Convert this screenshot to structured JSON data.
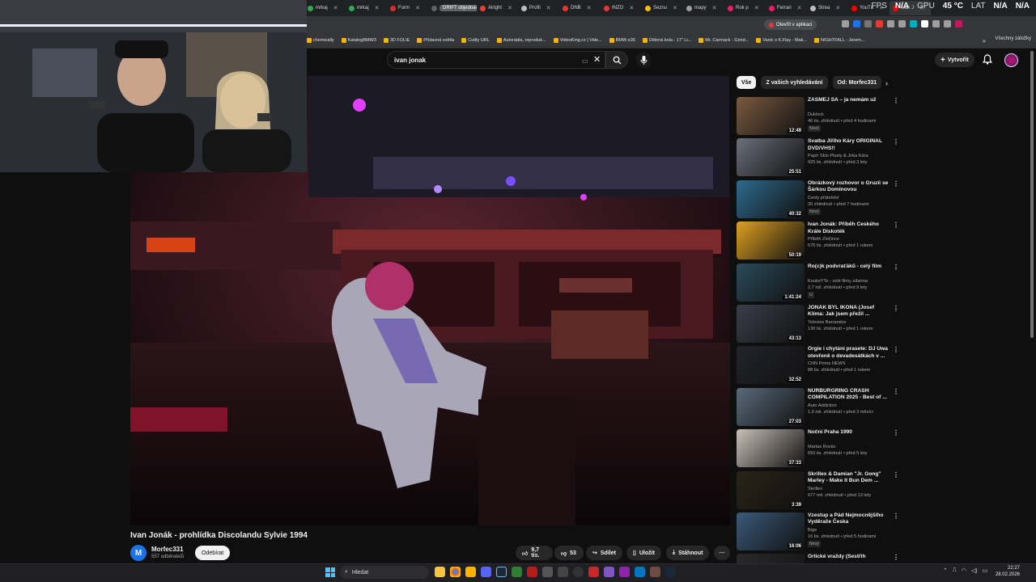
{
  "browser": {
    "tabs": [
      {
        "label": "mrkaj",
        "color": "#34a853"
      },
      {
        "label": "mrkaj",
        "color": "#34a853"
      },
      {
        "label": "Form",
        "color": "#d32f2f"
      },
      {
        "label": "DRIFT objednavky",
        "color": "#5f6368"
      },
      {
        "label": "Alright",
        "color": "#ea4335"
      },
      {
        "label": "Profil",
        "color": "#bdbdbd"
      },
      {
        "label": "DNB",
        "color": "#e53935"
      },
      {
        "label": "INZO",
        "color": "#e53935"
      },
      {
        "label": "Seznu",
        "color": "#fbbc04"
      },
      {
        "label": "mapy",
        "color": "#9e9e9e"
      },
      {
        "label": "Rok p",
        "color": "#e91e63"
      },
      {
        "label": "Ferrari",
        "color": "#e91e63"
      },
      {
        "label": "Strea",
        "color": "#bdbdbd"
      },
      {
        "label": "YouTu",
        "color": "#ff0000"
      },
      {
        "label": "Ivan J",
        "color": "#ff0000"
      }
    ],
    "stats": {
      "fps_label": "FPS",
      "fps": "N/A",
      "gpu_label": "GPU",
      "gpu": "45 °C",
      "lat_label": "LAT",
      "lat1": "N/A",
      "lat2": "N/A"
    },
    "open_app": "Otevřít v aplikaci",
    "bookmarks": [
      "chemically",
      "KatalogBMW3",
      "3D FOLIE",
      "Přídavná světla",
      "Cuttly URL",
      "Autorádia, reproduk...",
      "VideoKing.cz | Vide...",
      "BMW e36",
      "Dělená kola - 17\" Li...",
      "Mr. Carmack - Grind...",
      "Vanic x K.Flay - Mak...",
      "NIGHTFALL - Jerem..."
    ],
    "bookmarks_more": "»",
    "bookmarks_all": "Všechny záložky"
  },
  "youtube": {
    "search_value": "ivan jonak",
    "create_label": "Vytvořit",
    "video": {
      "title": "Ivan Jonák - prohlídka Discolandu Sylvie 1994",
      "channel": "Morfec331",
      "channel_initial": "M",
      "subscribers": "557 odběratelů",
      "subscribe_label": "Odebírat",
      "likes": "9,7 tis.",
      "dislikes": "53",
      "share_label": "Sdílet",
      "save_label": "Uložit",
      "download_label": "Stáhnout"
    },
    "chips": [
      "Vše",
      "Z vašich vyhledávání",
      "Od: Morfec331"
    ],
    "recommendations": [
      {
        "title": "ZASMEJ SA – ja nemám už",
        "channel": "Duklock",
        "meta": "46 tis. zhlédnutí • před 4 hodinami",
        "badge": "Nový",
        "duration": "12:49"
      },
      {
        "title": "Svatba Jiřího Káry ORIGINAL DVD/VHS!!",
        "channel": "Papír Sklo Plasty & Jirka Kára",
        "meta": "925 tis. zhlédnutí • před 3 lety",
        "badge": "",
        "duration": "25:51"
      },
      {
        "title": "Obrázkový rozhovor o Gruzii se Šárkou Dominovou",
        "channel": "Cesty přátelství",
        "meta": "30 zhlédnutí • před 7 hodinami",
        "badge": "Nový",
        "duration": "40:32"
      },
      {
        "title": "Ivan Jonák: Příběh Českého Krále Diskoték",
        "channel": "Příběh Zločince",
        "meta": "576 tis. zhlédnutí • před 1 rokem",
        "badge": "",
        "duration": "50:19"
      },
      {
        "title": "Ro(c)k podvraťáků - celý film",
        "channel": "KoukeYTe - celé filmy zdarma",
        "meta": "2,7 mil. zhlédnutí • před 9 lety",
        "badge": "U",
        "duration": "1:41:24"
      },
      {
        "title": "JONÁK BYL IKONA (Josef Klíma: Jak jsem přežil ...",
        "channel": "Televize Barrandov",
        "meta": "130 tis. zhlédnutí • před 1 rokem",
        "badge": "",
        "duration": "43:13"
      },
      {
        "title": "Orgie i chytání prasete: DJ Uwa otevřeně o devadesátkách v ...",
        "channel": "CNN Prima NEWS",
        "meta": "88 tis. zhlédnutí • před 1 rokem",
        "badge": "",
        "duration": "32:52"
      },
      {
        "title": "NÜRBURGRING CRASH COMPILATION 2025 - Best of ...",
        "channel": "Auto Addiction",
        "meta": "1,9 mil. zhlédnutí • před 3 měsíci",
        "badge": "",
        "duration": "27:03"
      },
      {
        "title": "Noční Praha 1990",
        "channel": "Martas Rocks",
        "meta": "650 tis. zhlédnutí • před 5 lety",
        "badge": "",
        "duration": "37:33"
      },
      {
        "title": "Skrillex & Damian \"Jr. Gong\" Marley - Make It Bun Dem ...",
        "channel": "Skrillex",
        "meta": "677 mil. zhlédnutí • před 13 lety",
        "badge": "",
        "duration": "3:39"
      },
      {
        "title": "Vzestup a Pád Nejmocnějšího Vyděrače Česka",
        "channel": "Bige",
        "meta": "16 tis. zhlédnutí • před 5 hodinami",
        "badge": "Nový",
        "duration": "16:06"
      },
      {
        "title": "Orlické vraždy (Sestřih",
        "channel": "",
        "meta": "",
        "badge": "",
        "duration": ""
      }
    ]
  },
  "taskbar": {
    "search_label": "Hledat",
    "time": "22:27",
    "date": "28.02.2026"
  }
}
